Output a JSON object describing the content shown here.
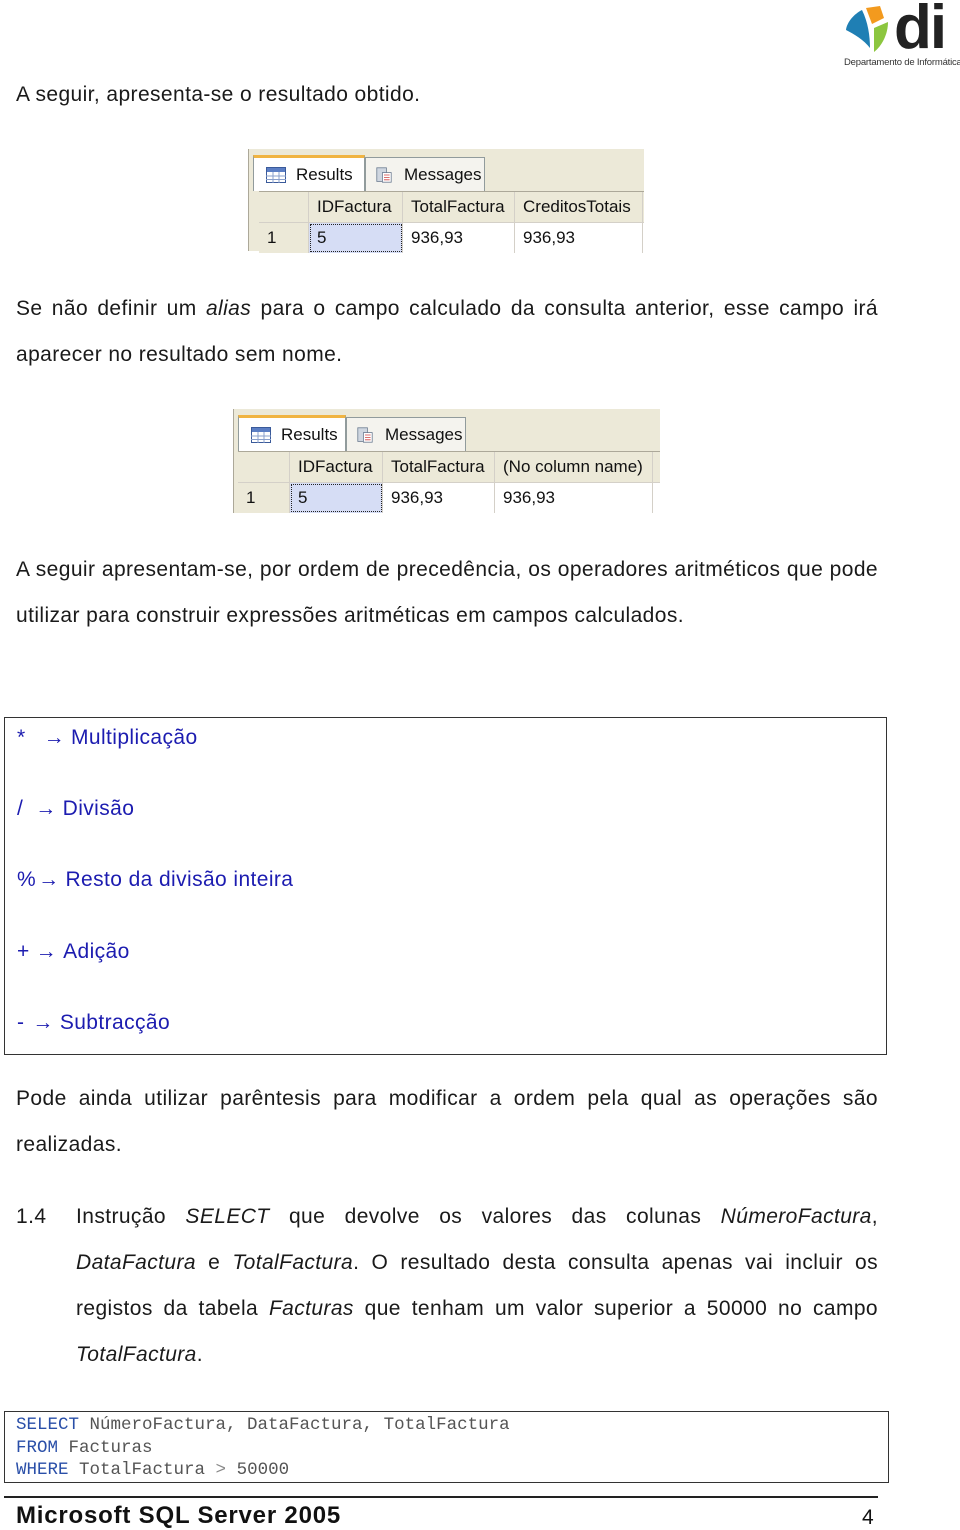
{
  "logo": {
    "text": "di",
    "subtitle": "Departamento de Informática",
    "colors": {
      "blue": "#1f7fb4",
      "orange": "#f39a1e",
      "green": "#8cc63f"
    }
  },
  "paragraphs": {
    "p1": "A seguir, apresenta-se o resultado obtido.",
    "p2_a": "Se não definir um ",
    "p2_em": "alias",
    "p2_b": " para o campo calculado da consulta anterior, esse campo irá aparecer no resultado sem nome.",
    "p3": "A seguir apresentam-se, por ordem de precedência, os operadores aritméticos que pode utilizar para construir expressões aritméticas em campos calculados.",
    "p4": "Pode ainda utilizar parêntesis para modificar a ordem pela qual as operações são realizadas."
  },
  "grid1": {
    "tabs": [
      "Results",
      "Messages"
    ],
    "columns": [
      "IDFactura",
      "TotalFactura",
      "CreditosTotais"
    ],
    "rows": [
      {
        "num": "1",
        "cells": [
          "5",
          "936,93",
          "936,93"
        ]
      }
    ]
  },
  "grid2": {
    "tabs": [
      "Results",
      "Messages"
    ],
    "columns": [
      "IDFactura",
      "TotalFactura",
      "(No column name)"
    ],
    "rows": [
      {
        "num": "1",
        "cells": [
          "5",
          "936,93",
          "936,93"
        ]
      }
    ]
  },
  "operators": [
    {
      "symbol": "*",
      "label": "Multiplicação"
    },
    {
      "symbol": "/",
      "label": "Divisão"
    },
    {
      "symbol": "%",
      "label": "Resto da divisão inteira"
    },
    {
      "symbol": "+",
      "label": "Adição"
    },
    {
      "symbol": "-",
      "label": "Subtracção"
    }
  ],
  "operator_color": "#1c1cb0",
  "section": {
    "number": "1.4",
    "t1": "Instrução ",
    "e1": "SELECT",
    "t2": " que devolve os valores das colunas ",
    "e2": "NúmeroFactura",
    "t3": ", ",
    "e3": "DataFactura",
    "t4": " e ",
    "e4": "TotalFactura",
    "t5": ". O resultado desta consulta apenas vai incluir os registos da tabela ",
    "e5": "Facturas",
    "t6": " que tenham um valor superior a 50000 no campo ",
    "e6": "TotalFactura",
    "t7": "."
  },
  "code": {
    "line1_kw": "SELECT",
    "line1_rest": " NúmeroFactura, DataFactura, TotalFactura",
    "line2_kw": "FROM",
    "line2_rest": " Facturas",
    "line3_kw": "WHERE",
    "line3_a": " TotalFactura ",
    "line3_op": ">",
    "line3_b": " 50000"
  },
  "footer": {
    "title": "Microsoft SQL Server 2005",
    "page": "4"
  }
}
